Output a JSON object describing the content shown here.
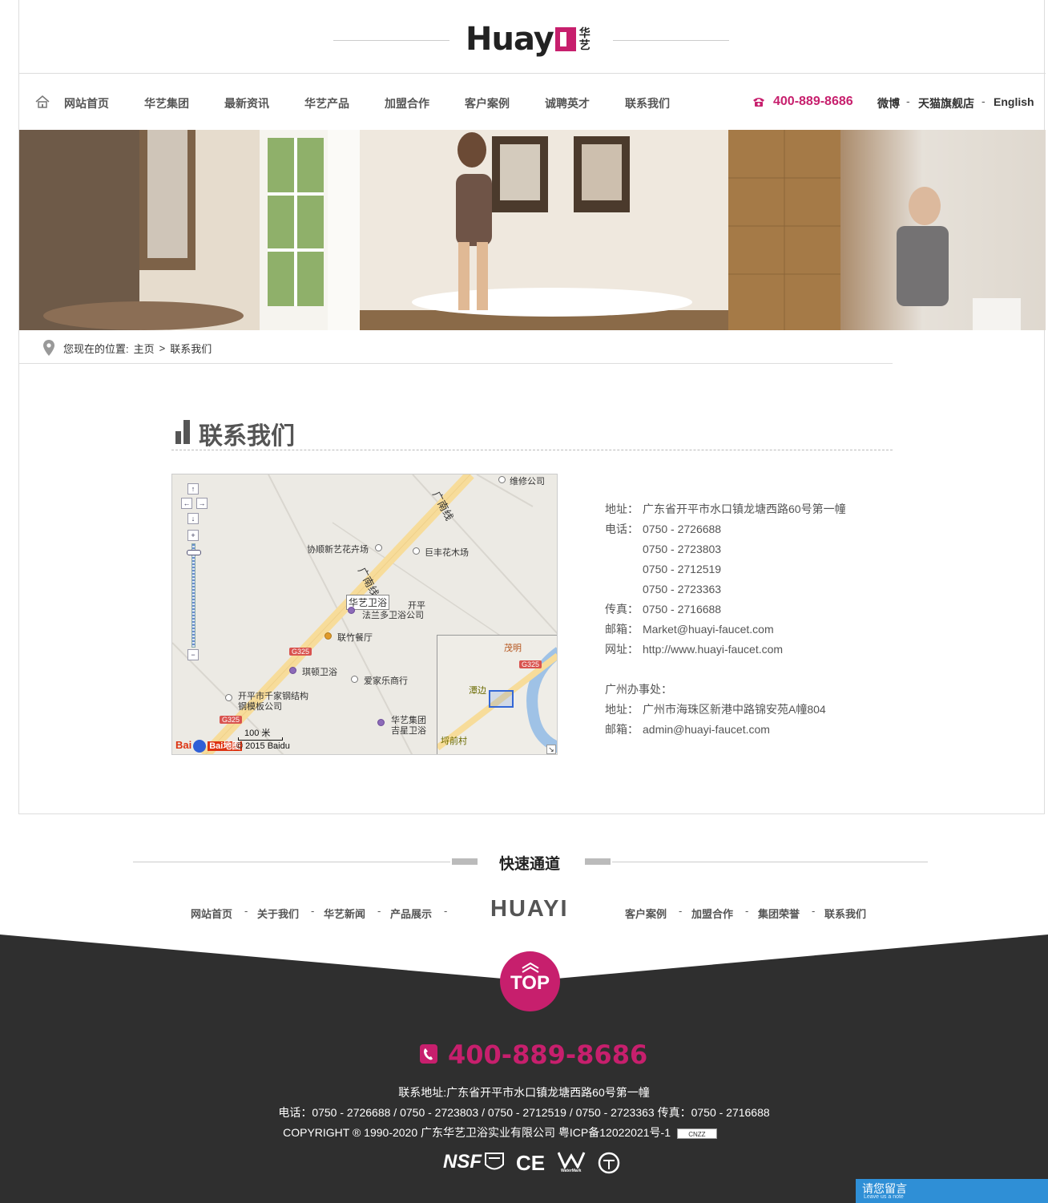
{
  "header": {
    "logo_text": "Huay",
    "logo_cn_1": "华",
    "logo_cn_2": "艺"
  },
  "nav": {
    "items": [
      "网站首页",
      "华艺集团",
      "最新资讯",
      "华艺产品",
      "加盟合作",
      "客户案例",
      "诚聘英才",
      "联系我们"
    ],
    "phone": "400-889-8686",
    "weibo": "微博",
    "tmall": "天猫旗舰店",
    "english": "English",
    "sep": "-"
  },
  "breadcrumb": {
    "prefix": "您现在的位置:",
    "home": "主页",
    "arrow": ">",
    "current": "联系我们"
  },
  "contact": {
    "title": "联系我们",
    "address_label": "地址：",
    "address": "广东省开平市水口镇龙塘西路60号第一幢",
    "tel_label": "电话：",
    "tels": [
      "0750 - 2726688",
      "0750 - 2723803",
      "0750 - 2712519",
      "0750 - 2723363"
    ],
    "fax_label": "传真：",
    "fax": "0750 - 2716688",
    "email_label": "邮箱：",
    "email": "Market@huayi-faucet.com",
    "web_label": "网址：",
    "web": "http://www.huayi-faucet.com",
    "gz_title": "广州办事处：",
    "gz_address_label": "地址：",
    "gz_address": "广州市海珠区新港中路锦安苑A幢804",
    "gz_email_label": "邮箱：",
    "gz_email": "admin@huayi-faucet.com"
  },
  "map": {
    "pois": {
      "repair": "维修公司",
      "flower1": "协顺新艺花卉场",
      "flower2": "巨丰花木场",
      "marker": "华艺卫浴",
      "kaiping": "开平",
      "falanduo": "法兰多卫浴公司",
      "lianzhu": "联竹餐厅",
      "qidun": "琪顿卫浴",
      "aijiale": "爱家乐商行",
      "steel1": "开平市千家钢结构",
      "steel2": "钢模板公司",
      "huayi_group1": "华艺集团",
      "huayi_group2": "吉星卫浴",
      "road": "广南线"
    },
    "highway": "G325",
    "scale": "100 米",
    "copyright": "© 2015 Baidu",
    "baidu_logo": "Bai地图",
    "mini": {
      "maoming": "茂明",
      "tangbian": "潭边",
      "qianmu": "埒前村"
    }
  },
  "quick": {
    "title": "快速通道",
    "left_links": [
      "网站首页",
      "关于我们",
      "华艺新闻",
      "产品展示"
    ],
    "logo": "HUAYI",
    "right_links": [
      "客户案例",
      "加盟合作",
      "集团荣誉",
      "联系我们"
    ],
    "sep": "-"
  },
  "footer": {
    "top": "TOP",
    "phone": "400-889-8686",
    "address_line": "联系地址:广东省开平市水口镇龙塘西路60号第一幢",
    "tel_line": "电话：0750 - 2726688 / 0750 - 2723803 / 0750 - 2712519 / 0750 - 2723363 传真：0750 - 2716688",
    "copyright_line": "COPYRIGHT ® 1990-2020 广东华艺卫浴实业有限公司 粤ICP备12022021号-1",
    "cnzz": "CNZZ",
    "certs": [
      "NSF",
      "CE",
      "WaterMark"
    ],
    "msg": "请您留言",
    "msg_sub": "Leave us a note"
  },
  "colors": {
    "brand": "#c71f6d",
    "footer_bg": "#2f2f2f",
    "message_blue": "#2f8fd6"
  }
}
